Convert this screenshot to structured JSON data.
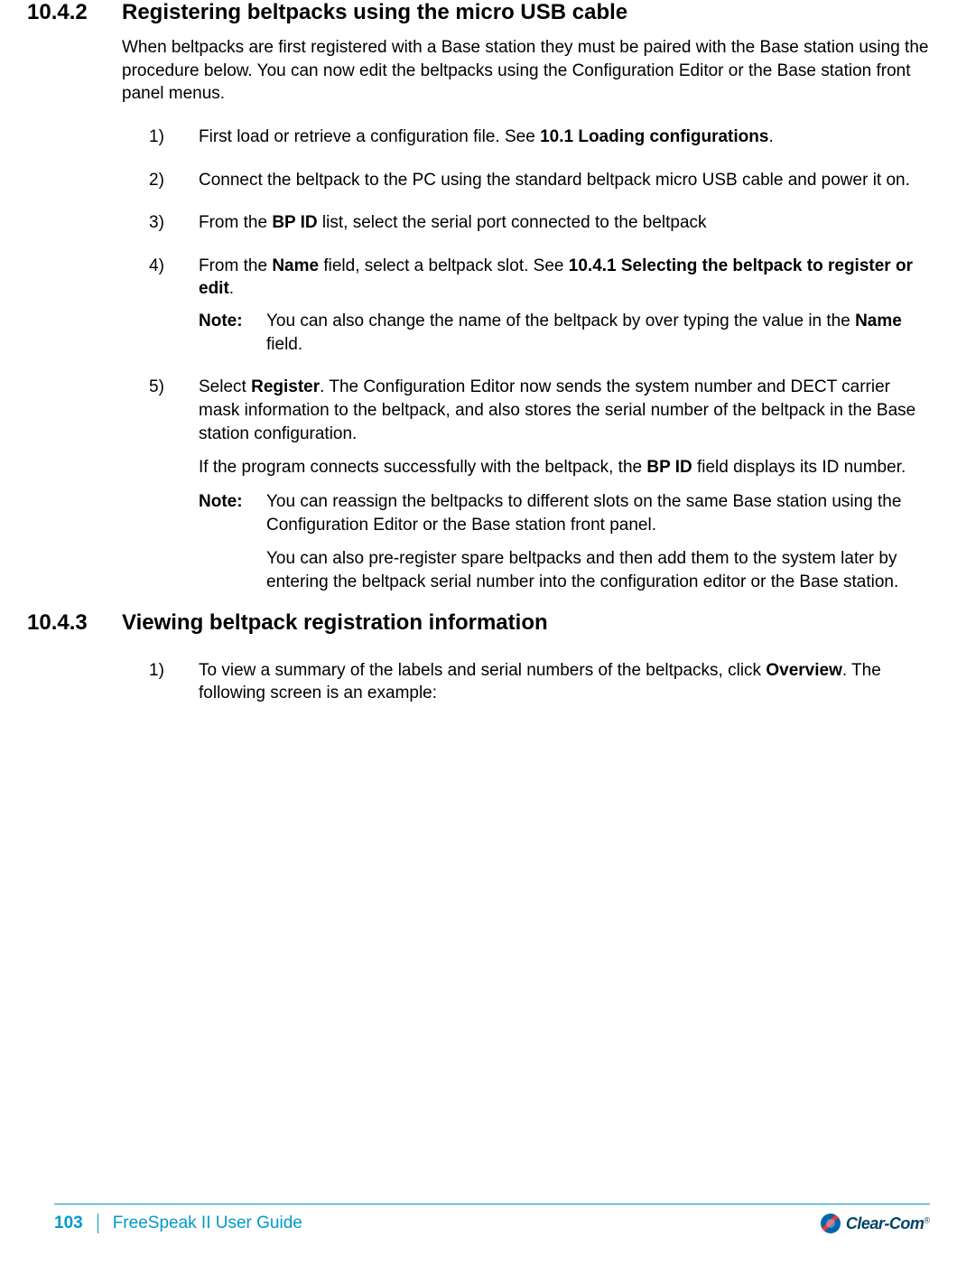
{
  "section1": {
    "number": "10.4.2",
    "title": "Registering beltpacks using the micro USB cable",
    "intro": "When beltpacks are first registered with a Base station they must be paired with the Base station using the procedure below. You can now edit the beltpacks using the Configuration Editor or the Base station front panel menus.",
    "items": {
      "i1": {
        "num": "1)",
        "before": "First load or retrieve a configuration file. See ",
        "bold": "10.1 Loading configurations",
        "after": "."
      },
      "i2": {
        "num": "2)",
        "text": "Connect the beltpack to the PC using the standard beltpack micro USB cable and power it on."
      },
      "i3": {
        "num": "3)",
        "before": "From the ",
        "bold": "BP ID",
        "after": " list, select the serial port connected to the beltpack"
      },
      "i4": {
        "num": "4)",
        "before": "From the ",
        "bold1": "Name",
        "mid": " field, select a beltpack slot. See ",
        "bold2": "10.4.1 Selecting the beltpack to register or edit",
        "after": "."
      },
      "i4note": {
        "label": "Note:",
        "before": "You can also change the name of the beltpack by over typing the value in the ",
        "bold": "Name",
        "after": " field."
      },
      "i5": {
        "num": "5)",
        "before": "Select ",
        "bold": "Register",
        "after": ". The Configuration Editor now sends the system number and DECT carrier mask information to the beltpack, and also stores the serial number of the beltpack in the Base station configuration."
      },
      "i5extra": {
        "before": "If the program connects successfully with the beltpack, the ",
        "bold": "BP ID",
        "after": " field displays its ID number."
      },
      "i5note": {
        "label": "Note:",
        "text": "You can reassign the beltpacks to different slots on the same Base station using the Configuration Editor or the Base station front panel."
      },
      "i5note2": {
        "text": "You can also pre-register spare beltpacks and then add them to the system later by entering the beltpack serial number into the configuration editor or the Base station."
      }
    }
  },
  "section2": {
    "number": "10.4.3",
    "title": "Viewing beltpack registration information",
    "items": {
      "i1": {
        "num": "1)",
        "before": "To view a summary of the labels and serial numbers of the beltpacks, click ",
        "bold": "Overview",
        "after": ". The following screen is an example:"
      }
    }
  },
  "footer": {
    "page": "103",
    "title": "FreeSpeak II User Guide",
    "logo": "Clear-Com"
  }
}
